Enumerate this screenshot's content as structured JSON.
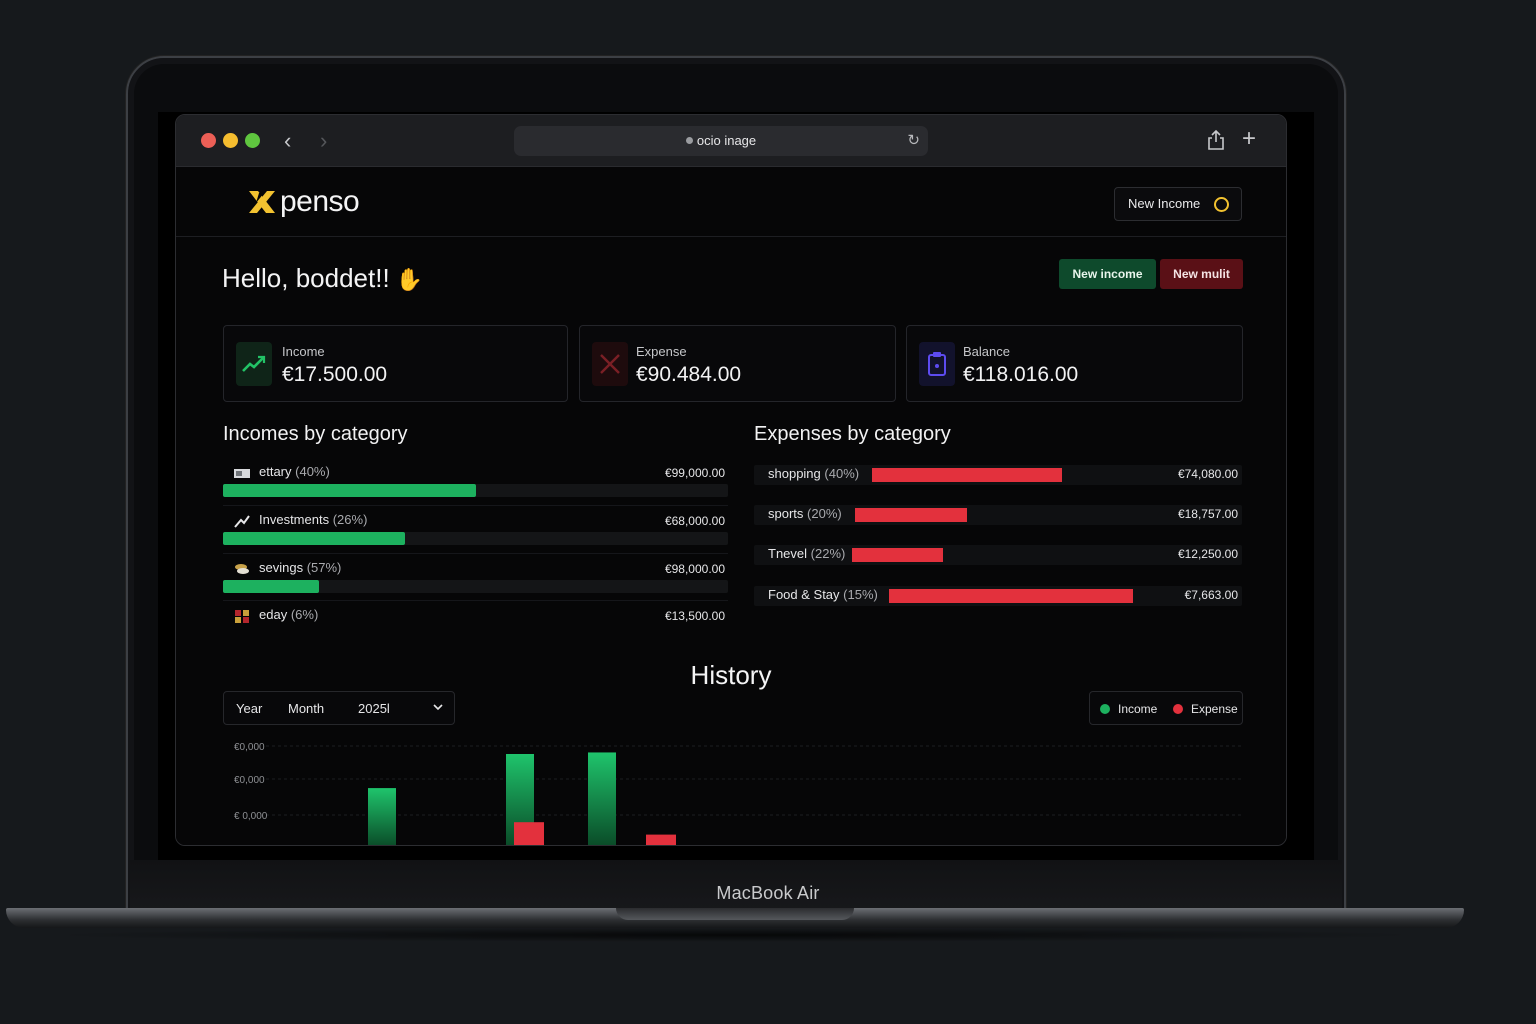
{
  "device": {
    "model": "MacBook Air"
  },
  "browser": {
    "address": "ocio inage",
    "nav_back": "‹",
    "nav_forward": "›",
    "reload": "↻",
    "new_tab": "+"
  },
  "app": {
    "logo_text": "penso",
    "header_button": "New Income",
    "greeting": "Hello, boddet!!",
    "greeting_emoji": "✋",
    "actions": {
      "new_income": "New income",
      "new_mult": "New mulit"
    },
    "stats": {
      "income": {
        "label": "Income",
        "value": "€17.500.00"
      },
      "expense": {
        "label": "Expense",
        "value": "€90.484.00"
      },
      "balance": {
        "label": "Balance",
        "value": "€118.016.00"
      }
    },
    "incomes_title": "Incomes by category",
    "expenses_title": "Expenses by category",
    "incomes": [
      {
        "name": "ettary",
        "pct": "(40%)",
        "amount": "€99,000.00",
        "fill": 0.5
      },
      {
        "name": "Investments",
        "pct": "(26%)",
        "amount": "€68,000.00",
        "fill": 0.36
      },
      {
        "name": "sevings",
        "pct": "(57%)",
        "amount": "€98,000.00",
        "fill": 0.19
      },
      {
        "name": "eday",
        "pct": "(6%)",
        "amount": "€13,500.00",
        "fill": 0
      }
    ],
    "expenses": [
      {
        "name": "shopping",
        "pct": "(40%)",
        "amount": "€74,080.00"
      },
      {
        "name": "sports",
        "pct": "(20%)",
        "amount": "€18,757.00"
      },
      {
        "name": "Tnevel",
        "pct": "(22%)",
        "amount": "€12,250.00"
      },
      {
        "name": "Food & Stay",
        "pct": "(15%)",
        "amount": "€7,663.00"
      }
    ],
    "history": {
      "title": "History",
      "year_label": "Year",
      "month_label": "Month",
      "selected": "2025l",
      "legend_income": "Income",
      "legend_expense": "Expense"
    }
  },
  "colors": {
    "income": "#1db15f",
    "expense": "#e3313d",
    "accent": "#f2c230"
  },
  "chart_data": {
    "type": "bar",
    "y_tick_labels": [
      "€0,000",
      "€0,000",
      "€ 0,000"
    ],
    "series": [
      {
        "name": "Income",
        "values": [
          0,
          38,
          0,
          60,
          0,
          0,
          61,
          0
        ]
      },
      {
        "name": "Expense",
        "values": [
          0,
          0,
          0,
          0,
          16,
          0,
          0,
          8
        ]
      }
    ],
    "ylim": [
      0,
      100
    ],
    "grid": true,
    "legend": "top-right"
  }
}
